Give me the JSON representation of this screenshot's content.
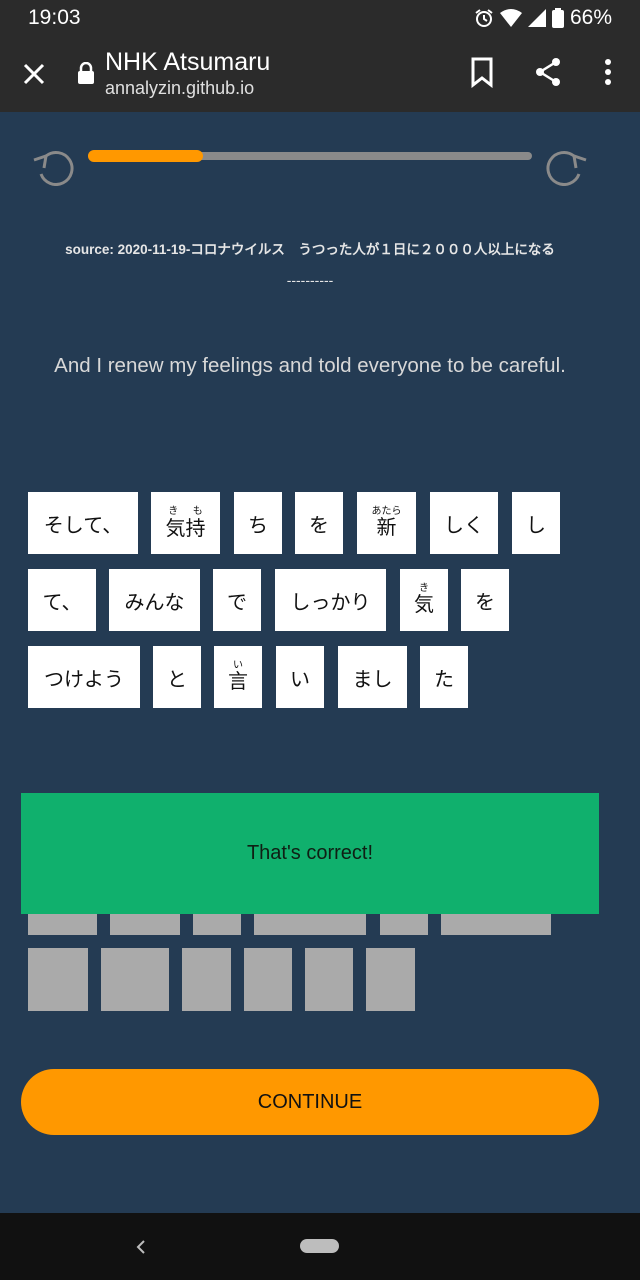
{
  "status": {
    "time": "19:03",
    "battery": "66%"
  },
  "browser": {
    "title": "NHK Atsumaru",
    "url": "annalyzin.github.io"
  },
  "progress": {
    "fraction": 0.26
  },
  "source_text": "source: 2020-11-19-コロナウイルス　うつった人が１日に２０００人以上になる",
  "divider_text": "----------",
  "translation": "And I renew my feelings and told everyone to be careful.",
  "tiles": [
    {
      "text": "そして、"
    },
    {
      "base": "気持",
      "ruby": "き も"
    },
    {
      "text": "ち"
    },
    {
      "text": "を"
    },
    {
      "base": "新",
      "ruby": "あたら"
    },
    {
      "text": "しく"
    },
    {
      "text": "し"
    },
    {
      "text": "て、"
    },
    {
      "text": "みんな"
    },
    {
      "text": "で"
    },
    {
      "text": "しっかり"
    },
    {
      "base": "気",
      "ruby": "き"
    },
    {
      "text": "を"
    },
    {
      "text": "つけよう"
    },
    {
      "text": "と"
    },
    {
      "base": "言",
      "ruby": "い"
    },
    {
      "text": "い"
    },
    {
      "text": "まし"
    },
    {
      "text": "た"
    }
  ],
  "feedback": "That's correct!",
  "continue_label": "CONTINUE",
  "colors": {
    "background": "#243b53",
    "accent": "#ff9800",
    "success": "#10b06d"
  }
}
